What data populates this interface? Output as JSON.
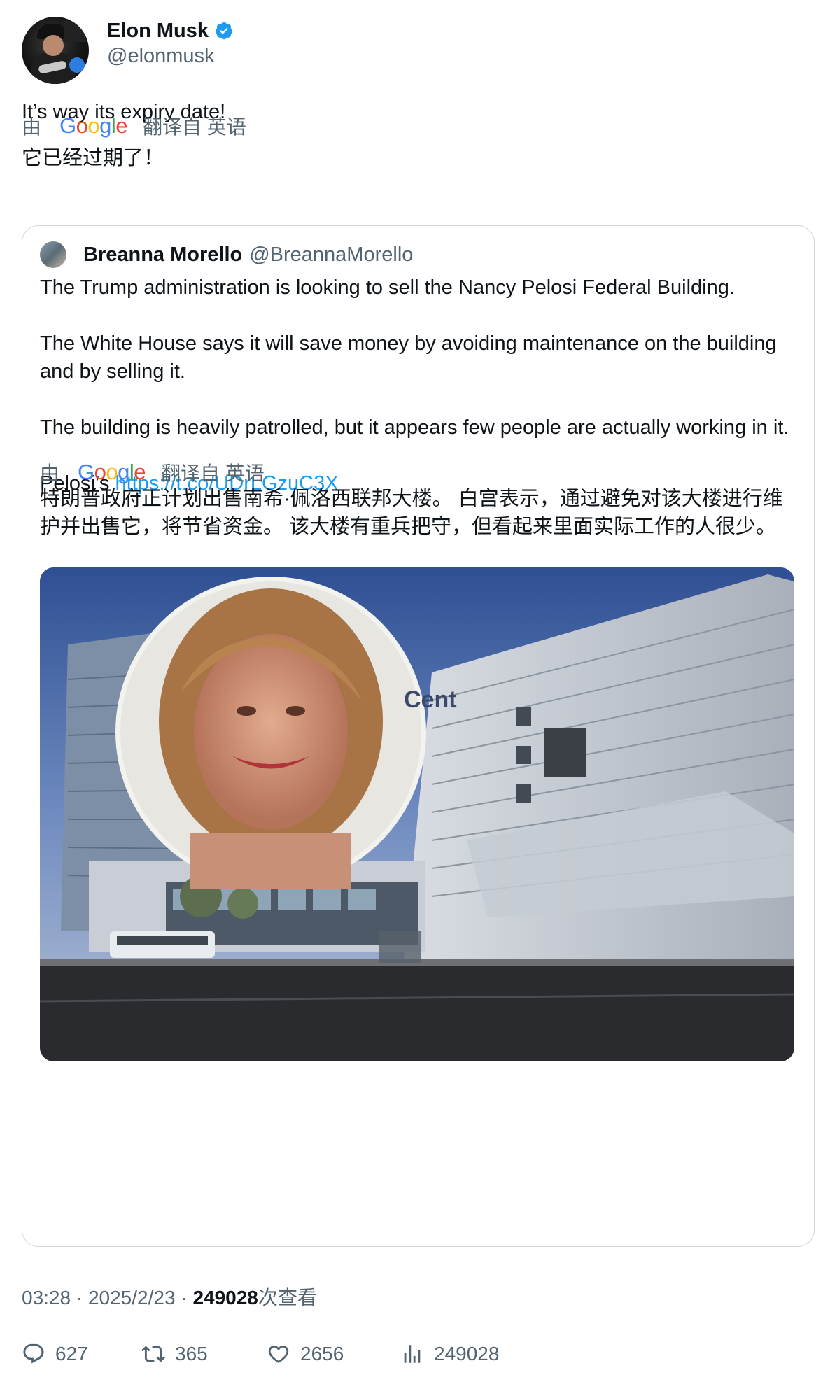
{
  "author": {
    "display_name": "Elon Musk",
    "handle": "@elonmusk",
    "verified": true
  },
  "tweet": {
    "text": "It’s way its expiry date!",
    "translation": {
      "by": "由",
      "provider": "Google",
      "from_label": "翻译自 英语",
      "text": "它已经过期了！"
    }
  },
  "quoted_tweet": {
    "display_name": "Breanna Morello",
    "handle": "@BreannaMorello",
    "paragraphs": [
      "The Trump administration is looking to sell the Nancy Pelosi Federal Building.",
      "The White House says it will save money by avoiding maintenance on the building and by selling it.",
      "The building is heavily patrolled, but it appears few people are actually working in it."
    ],
    "last_line_prefix": "Pelosi’s ",
    "link": "https://t.co/UDrLGzuC3X",
    "translation": {
      "by": "由",
      "provider": "Google",
      "from_label": "翻译自 英语",
      "text": "特朗普政府正计划出售南希·佩洛西联邦大楼。 白宫表示，通过避免对该大楼进行维护并出售它，将节省资金。 该大楼有重兵把守，但看起来里面实际工作的人很少。"
    }
  },
  "meta": {
    "time": "03:28",
    "date": "2025/2/23",
    "separator": " · ",
    "views_count": "249028",
    "views_label": "次查看"
  },
  "actions": {
    "replies": "627",
    "reposts": "365",
    "likes": "2656",
    "views": "249028"
  },
  "colors": {
    "link": "#1d9bf0",
    "verified": "#1d9bf0",
    "muted": "#536471"
  }
}
